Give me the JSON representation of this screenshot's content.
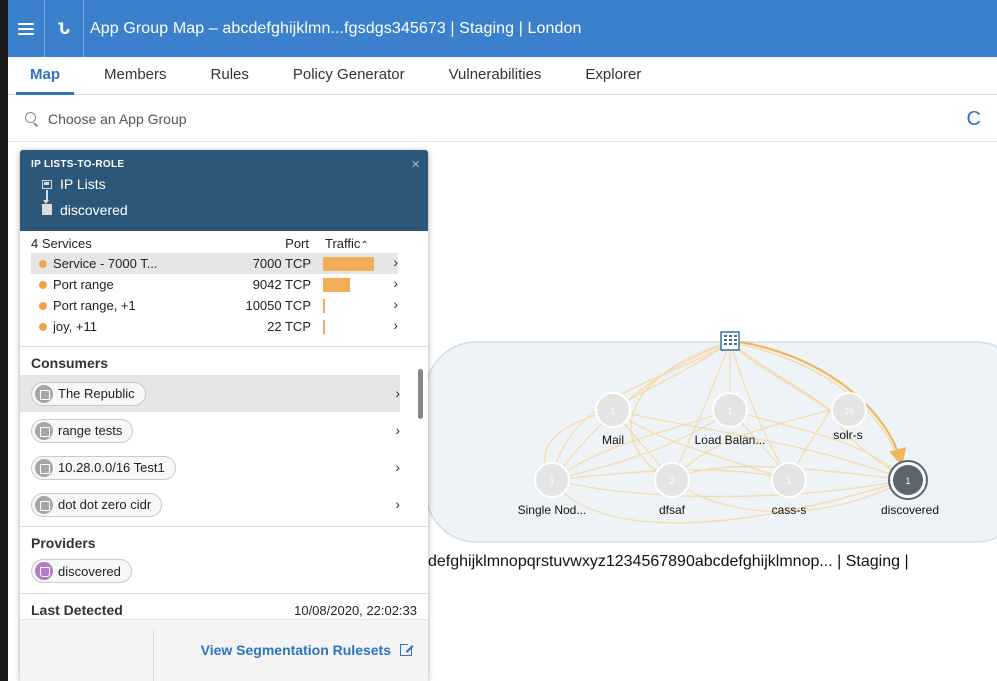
{
  "header": {
    "title": "App Group Map – abcdefghijklmn...fgsdgs345673 | Staging | London",
    "back_glyph": "Ն"
  },
  "tabs": [
    {
      "label": "Map",
      "active": true
    },
    {
      "label": "Members"
    },
    {
      "label": "Rules"
    },
    {
      "label": "Policy Generator"
    },
    {
      "label": "Vulnerabilities"
    },
    {
      "label": "Explorer"
    }
  ],
  "search": {
    "placeholder": "Choose an App Group"
  },
  "refresh_glyph": "C",
  "panel": {
    "caption": "IP LISTS-TO-ROLE",
    "close_glyph": "×",
    "from": "IP Lists",
    "to": "discovered",
    "services": {
      "count_label": "4 Services",
      "port_header": "Port",
      "traffic_header": "Traffic",
      "sort_glyph": "⌃",
      "rows": [
        {
          "name": "Service - 7000 T...",
          "port": "7000 TCP",
          "traffic": 0.85,
          "highlighted": true
        },
        {
          "name": "Port range",
          "port": "9042 TCP",
          "traffic": 0.45
        },
        {
          "name": "Port range, +1",
          "port": "10050 TCP",
          "traffic": 0.04
        },
        {
          "name": "joy, +11",
          "port": "22 TCP",
          "traffic": 0.04
        }
      ]
    },
    "consumers_title": "Consumers",
    "consumers": [
      {
        "label": "The Republic",
        "highlighted": true
      },
      {
        "label": "range tests"
      },
      {
        "label": "10.28.0.0/16 Test1"
      },
      {
        "label": "dot dot zero cidr"
      }
    ],
    "providers_title": "Providers",
    "providers": [
      {
        "label": "discovered"
      }
    ],
    "last_detected_label": "Last Detected",
    "last_detected_value": "10/08/2020, 22:02:33",
    "footer_link": "View Segmentation Rulesets"
  },
  "chevron_glyph": "›",
  "map": {
    "group_label": "defghijklmnopqrstuvwxyz1234567890abcdefghijklmnop... | Staging |",
    "nodes": [
      {
        "id": "mail",
        "count": "1",
        "label": "Mail"
      },
      {
        "id": "load",
        "count": "1",
        "label": "Load Balan..."
      },
      {
        "id": "solr",
        "count": "26",
        "label": "solr-s"
      },
      {
        "id": "single",
        "count": "1",
        "label": "Single Nod..."
      },
      {
        "id": "dfsaf",
        "count": "2",
        "label": "dfsaf"
      },
      {
        "id": "cass",
        "count": "1",
        "label": "cass-s"
      },
      {
        "id": "disc",
        "count": "1",
        "label": "discovered"
      }
    ],
    "colors": {
      "edge": "#f5d9a8",
      "highlight_edge": "#f2b55a",
      "node_fill": "#e4e4e4",
      "selected_node": "#5a6570"
    }
  }
}
